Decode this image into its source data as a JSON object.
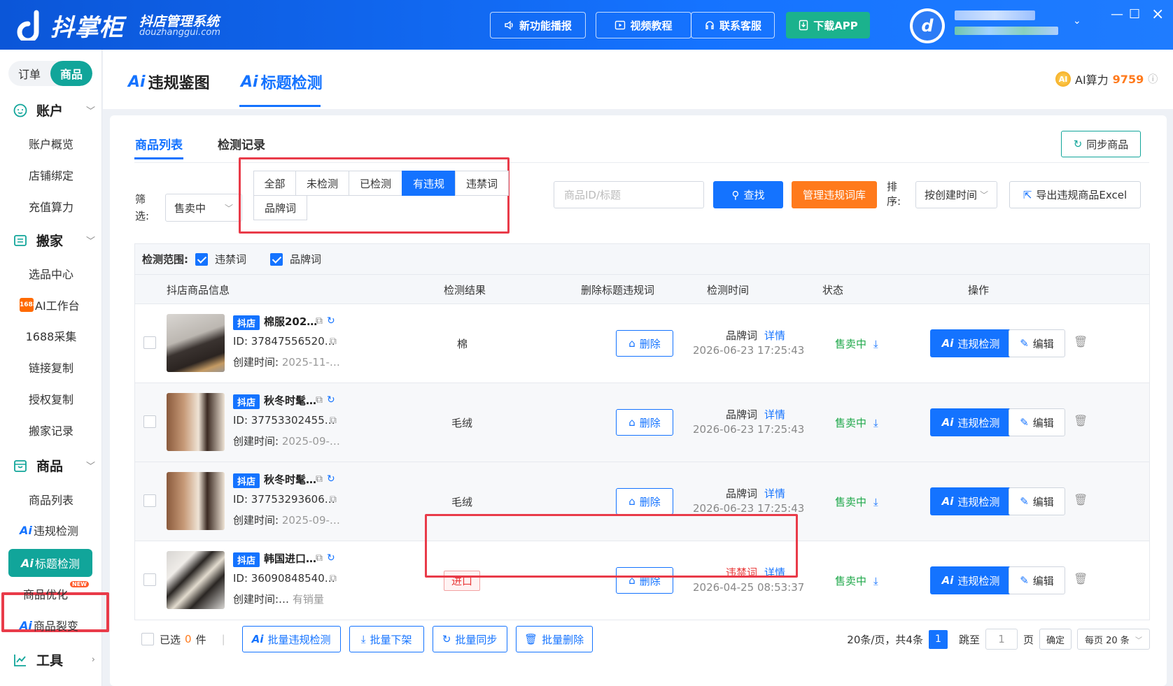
{
  "header": {
    "brand": "抖掌柜",
    "brand_sub": "抖店管理系统",
    "brand_url": "douzhanggui.com",
    "buttons": [
      {
        "label": "新功能播报",
        "icon": "speaker-icon"
      },
      {
        "label": "视频教程",
        "icon": "video-icon"
      },
      {
        "label": "联系客服",
        "icon": "headset-icon"
      },
      {
        "label": "下载APP",
        "icon": "download-icon"
      }
    ]
  },
  "sidebar": {
    "toggle": [
      "订单",
      "商品"
    ],
    "sections": {
      "account": {
        "label": "账户",
        "items": [
          "账户概览",
          "店铺绑定",
          "充值算力"
        ]
      },
      "move": {
        "label": "搬家",
        "items": [
          "选品中心",
          "AI工作台",
          "1688采集",
          "链接复制",
          "授权复制",
          "搬家记录"
        ]
      },
      "goods": {
        "label": "商品",
        "items": [
          "商品列表",
          "违规检测",
          "标题检测",
          "商品优化",
          "商品裂变"
        ]
      },
      "tools": {
        "label": "工具"
      }
    },
    "ai_prefix": "Ai",
    "new_badge": "NEW"
  },
  "topbar": {
    "tabs": [
      {
        "ai": "Ai",
        "label": "违规鉴图"
      },
      {
        "ai": "Ai",
        "label": "标题检测"
      }
    ],
    "ai_power_label": "AI算力",
    "ai_power_value": "9759"
  },
  "panel": {
    "subtabs": [
      "商品列表",
      "检测记录"
    ],
    "sync_button": "同步商品",
    "filter_label": "筛选:",
    "filter_select": "售卖中",
    "filter_buttons": [
      "全部",
      "未检测",
      "已检测",
      "有违规",
      "违禁词",
      "品牌词"
    ],
    "search_placeholder": "商品ID/标题",
    "search_button": "查找",
    "manage_button": "管理违规词库",
    "sort_label": "排序:",
    "sort_select": "按创建时间",
    "export_button": "导出违规商品Excel",
    "range_label": "检测范围:",
    "range_options": [
      "违禁词",
      "品牌词"
    ],
    "columns": [
      "抖店商品信息",
      "检测结果",
      "删除标题违规词",
      "检测时间",
      "状态",
      "操作"
    ],
    "rows": [
      {
        "shop": "抖店",
        "name": "棉服202…",
        "id": "ID: 37847556520…",
        "created_label": "创建时间:",
        "created": "2025-11-…",
        "result": "棉",
        "del": "删除",
        "dtype": "品牌词",
        "detail": "详情",
        "dtime": "2026-06-23 17:25:43",
        "status": "售卖中",
        "ai_btn": "违规检测",
        "edit": "编辑"
      },
      {
        "shop": "抖店",
        "name": "秋冬时髦…",
        "id": "ID: 37753302455…",
        "created_label": "创建时间:",
        "created": "2025-09-…",
        "result": "毛绒",
        "del": "删除",
        "dtype": "品牌词",
        "detail": "详情",
        "dtime": "2026-06-23 17:25:43",
        "status": "售卖中",
        "ai_btn": "违规检测",
        "edit": "编辑"
      },
      {
        "shop": "抖店",
        "name": "秋冬时髦…",
        "id": "ID: 37753293606…",
        "created_label": "创建时间:",
        "created": "2025-09-…",
        "result": "毛绒",
        "del": "删除",
        "dtype": "品牌词",
        "detail": "详情",
        "dtime": "2026-06-23 17:25:43",
        "status": "售卖中",
        "ai_btn": "违规检测",
        "edit": "编辑"
      },
      {
        "shop": "抖店",
        "name": "韩国进口…",
        "id": "ID: 36090848540…",
        "created_label": "创建时间:…",
        "created": "有销量",
        "result": "进口",
        "del": "删除",
        "dtype": "违禁词",
        "detail": "详情",
        "dtime": "2026-04-25 08:53:37",
        "status": "售卖中",
        "ai_btn": "违规检测",
        "edit": "编辑"
      }
    ],
    "footer": {
      "selected_prefix": "已选",
      "selected_count": "0",
      "selected_suffix": "件",
      "batch_buttons": [
        "批量违规检测",
        "批量下架",
        "批量同步",
        "批量删除"
      ],
      "page_info": "20条/页，共4条",
      "current_page": "1",
      "jump_label": "跳至",
      "jump_value": "1",
      "page_unit": "页",
      "confirm": "确定",
      "per_page": "每页 20 条"
    }
  },
  "colors": {
    "primary": "#1473ff",
    "teal": "#11a59a",
    "orange": "#ff7a1c",
    "danger": "#e93b49",
    "success": "#1fa84a"
  }
}
